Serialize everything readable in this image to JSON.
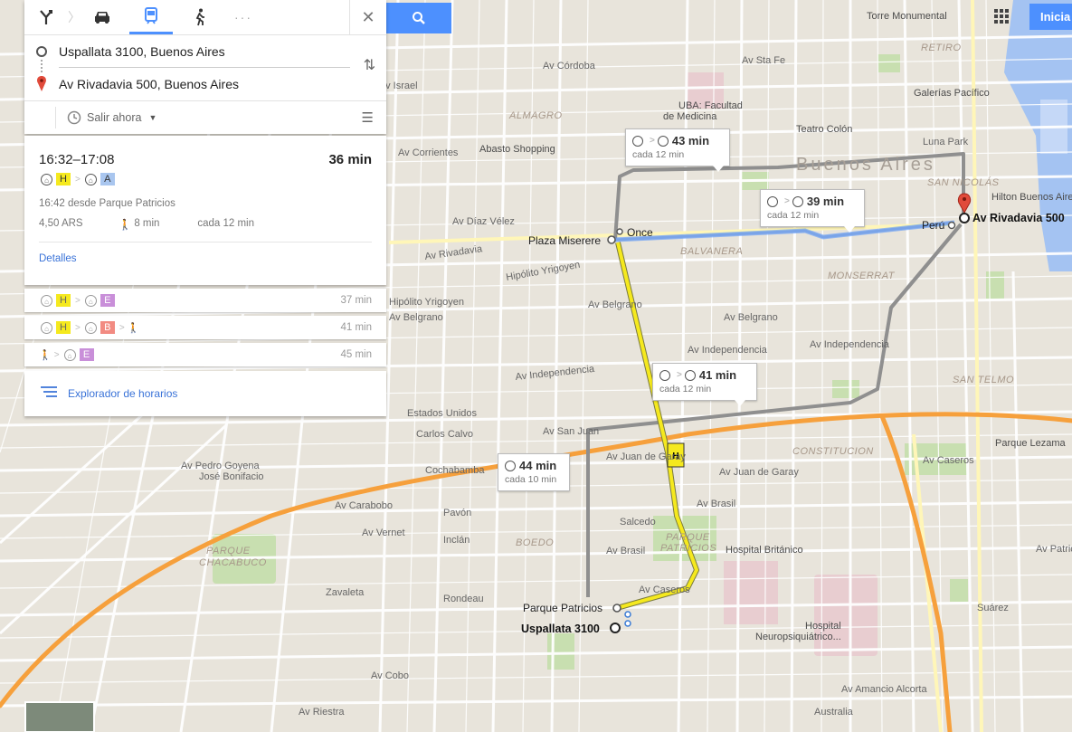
{
  "panel": {
    "origin": "Uspallata 3100, Buenos Aires",
    "destination": "Av Rivadavia 500, Buenos Aires",
    "depart_label": "Salir ahora"
  },
  "route_main": {
    "time_range": "16:32–17:08",
    "duration": "36 min",
    "line1": "H",
    "line2": "A",
    "depart_info": "16:42 desde Parque Patricios",
    "fare": "4,50 ARS",
    "walk": "8 min",
    "frequency": "cada 12 min",
    "details_link": "Detalles"
  },
  "alternatives": [
    {
      "lines": [
        "H",
        "E"
      ],
      "duration": "37 min"
    },
    {
      "lines": [
        "H",
        "B"
      ],
      "duration": "41 min"
    },
    {
      "lines": [
        "E"
      ],
      "duration": "45 min"
    }
  ],
  "schedule_explorer": "Explorador de horarios",
  "map": {
    "city_label": "Buenos Aires",
    "start_label": "Uspallata 3100",
    "end_label": "Av Rivadavia 500",
    "stops": [
      "Plaza Miserere",
      "Once",
      "Perú",
      "Parque Patricios"
    ],
    "callouts": [
      {
        "duration": "43 min",
        "freq": "cada 12 min"
      },
      {
        "duration": "39 min",
        "freq": "cada 12 min"
      },
      {
        "duration": "41 min",
        "freq": "cada 12 min"
      },
      {
        "duration": "44 min",
        "freq": "cada 10 min"
      }
    ],
    "signin": "Inicia"
  },
  "colors": {
    "line_h": "#f5e91e",
    "line_a": "#a9c6ef",
    "line_e": "#c98fd9",
    "line_b": "#f28b82",
    "route_blue": "#7aa4e8",
    "highway": "#f6a03c",
    "accent": "#4d90fe"
  }
}
